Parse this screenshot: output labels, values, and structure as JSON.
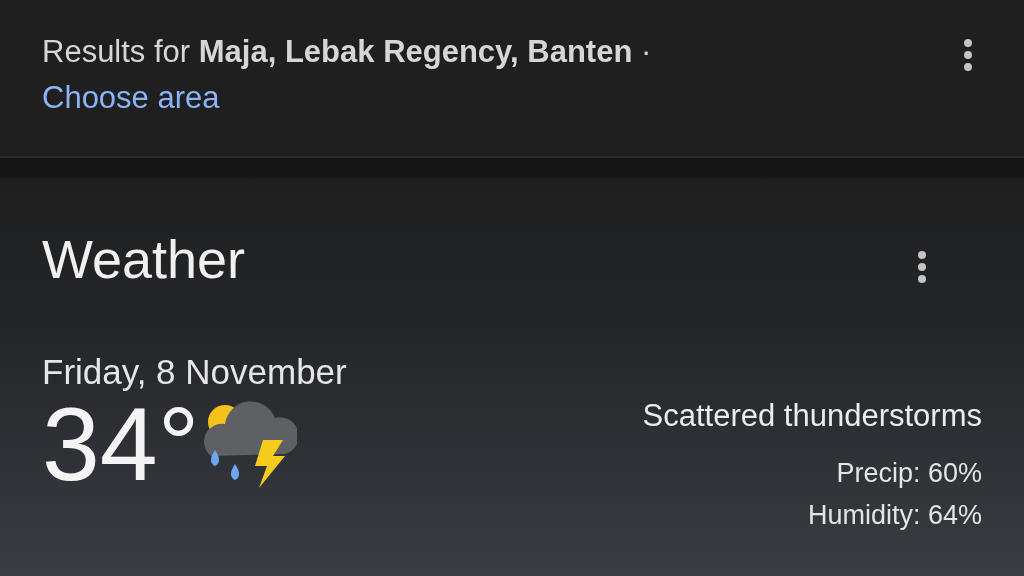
{
  "results_header": {
    "text": "Results for **Maja, Lebak Regency, Banten** ·",
    "link": "Choose area"
  },
  "weather": {
    "title": "Weather",
    "date": "Friday, 8 November",
    "temperature": "34°",
    "condition": "Scattered thunderstorms",
    "details": [
      "Precip: 60%",
      "Humidity: 64%"
    ]
  }
}
